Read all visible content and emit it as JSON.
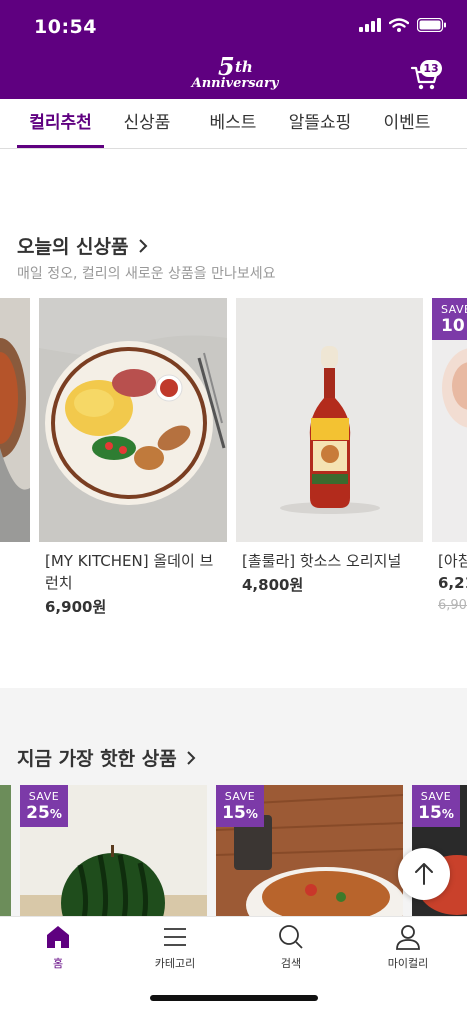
{
  "status_bar": {
    "time": "10:54"
  },
  "header": {
    "logo": {
      "number": "5",
      "suffix": "th",
      "word": "Anniversary"
    },
    "cart_count": "13",
    "color_brand": "#5f0080"
  },
  "tabs": [
    {
      "label": "컬리추천",
      "active": true
    },
    {
      "label": "신상품",
      "active": false
    },
    {
      "label": "베스트",
      "active": false
    },
    {
      "label": "알뜰쇼핑",
      "active": false
    },
    {
      "label": "이벤트",
      "active": false
    }
  ],
  "new_products": {
    "title": "오늘의 신상품",
    "subtitle": "매일 정오, 컬리의 새로운 상품을 만나보세요",
    "items": [
      {
        "name": "[MY KITCHEN] 올데이 브런치",
        "price": "6,900원"
      },
      {
        "name": "[촐룰라] 핫소스 오리지널",
        "price": "4,800원"
      },
      {
        "name": "[아침",
        "price": "6,21",
        "original_price": "6,90",
        "save_prefix": "SAVE",
        "save_percent": "10"
      }
    ]
  },
  "hot_products": {
    "title": "지금 가장 핫한 상품",
    "items": [
      {
        "save_prefix": "SAVE",
        "save_percent": "25",
        "save_unit": "%"
      },
      {
        "save_prefix": "SAVE",
        "save_percent": "15",
        "save_unit": "%"
      },
      {
        "save_prefix": "SAVE",
        "save_percent": "15",
        "save_unit": "%"
      }
    ]
  },
  "bottom_nav": [
    {
      "label": "홈",
      "icon": "home-icon",
      "active": true
    },
    {
      "label": "카테고리",
      "icon": "menu-icon",
      "active": false
    },
    {
      "label": "검색",
      "icon": "search-icon",
      "active": false
    },
    {
      "label": "마이컬리",
      "icon": "person-icon",
      "active": false
    }
  ]
}
